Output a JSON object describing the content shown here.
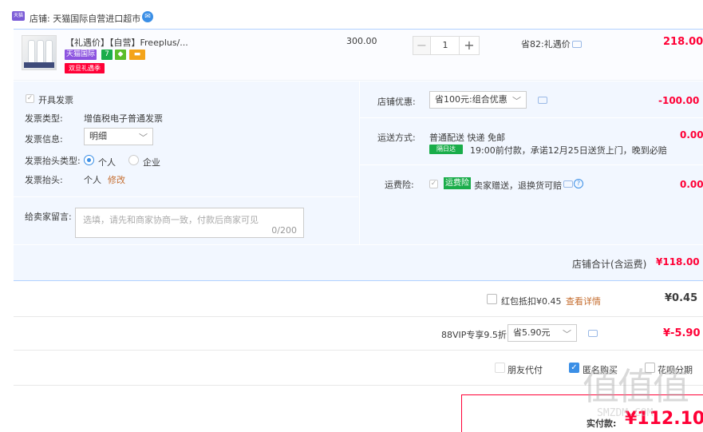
{
  "shop": {
    "badge": "天猫",
    "name": "店铺: 天猫国际自营进口超市"
  },
  "item": {
    "title": "【礼遇价】【自营】Freeplus/...",
    "tags": {
      "tmall_intl": "天猫国际",
      "seven": "7",
      "promo": "双旦礼遇季"
    },
    "unit_price": "300.00",
    "quantity": "1",
    "minus": "−",
    "plus": "+",
    "savings": "省82:礼遇价",
    "total": "218.00"
  },
  "invoice": {
    "issue_label": "开具发票",
    "type_label": "发票类型:",
    "type_value": "增值税电子普通发票",
    "info_label": "发票信息:",
    "info_value": "明细",
    "header_type_label": "发票抬头类型:",
    "option_personal": "个人",
    "option_company": "企业",
    "header_label": "发票抬头:",
    "header_value": "个人",
    "modify_link": "修改"
  },
  "message": {
    "label": "给卖家留言:",
    "placeholder": "选填，请先和商家协商一致，付款后商家可见",
    "counter": "0/200"
  },
  "shop_discount": {
    "label": "店铺优惠:",
    "select_value": "省100元:组合优惠",
    "amount": "-100.00"
  },
  "shipping": {
    "label": "运送方式:",
    "method": "普通配送 快递 免邮",
    "badge": "隔日达",
    "promise": "19:00前付款，承诺12月25日送货上门，晚到必赔",
    "amount": "0.00"
  },
  "insurance": {
    "label": "运费险:",
    "badge": "运费险",
    "desc": "卖家赠送，退换货可赔",
    "amount": "0.00"
  },
  "shop_total": {
    "label": "店铺合计(含运费)",
    "amount": "¥118.00"
  },
  "red_packet": {
    "label": "红包抵扣¥0.45",
    "link": "查看详情",
    "amount": "¥0.45"
  },
  "vip": {
    "label": "88VIP专享9.5折",
    "select_value": "省5.90元",
    "amount": "¥-5.90"
  },
  "options": {
    "friend_pay": "朋友代付",
    "anonymous": "匿名购买",
    "installment": "花呗分期"
  },
  "payment": {
    "label": "实付款:",
    "amount": "¥112.10"
  },
  "watermark": {
    "text": "值值值",
    "url": "SMZDM.COM"
  },
  "colors": {
    "accent_red": "#ff0036",
    "accent_blue": "#3b8fe6",
    "panel_bg": "#f2f7ff",
    "link_orange": "#c56d2f"
  }
}
